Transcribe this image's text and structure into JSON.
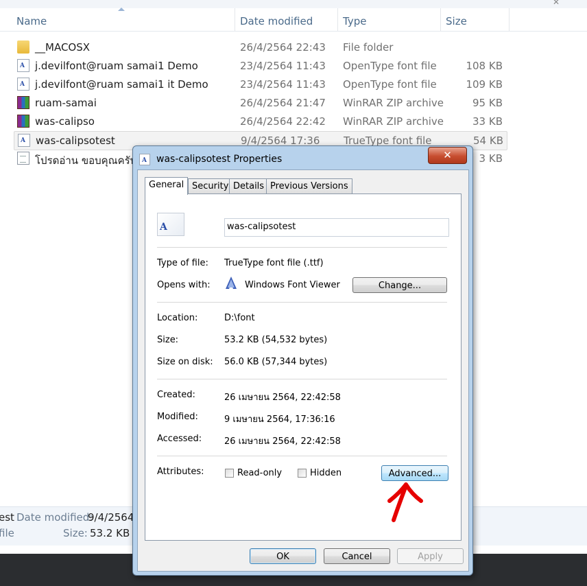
{
  "explorer": {
    "columns": {
      "name": "Name",
      "date": "Date modified",
      "type": "Type",
      "size": "Size"
    },
    "files": [
      {
        "name": "__MACOSX",
        "date": "26/4/2564 22:43",
        "type": "File folder",
        "size": "",
        "icon": "folder-icon"
      },
      {
        "name": "j.devilfont@ruam samai1 Demo",
        "date": "23/4/2564 11:43",
        "type": "OpenType font file",
        "size": "108 KB",
        "icon": "font-file-icon"
      },
      {
        "name": "j.devilfont@ruam samai1 it Demo",
        "date": "23/4/2564 11:43",
        "type": "OpenType font file",
        "size": "109 KB",
        "icon": "font-file-icon"
      },
      {
        "name": "ruam-samai",
        "date": "26/4/2564 21:47",
        "type": "WinRAR ZIP archive",
        "size": "95 KB",
        "icon": "winrar-archive-icon"
      },
      {
        "name": "was-calipso",
        "date": "26/4/2564 22:42",
        "type": "WinRAR ZIP archive",
        "size": "33 KB",
        "icon": "winrar-archive-icon"
      },
      {
        "name": "was-calipsotest",
        "date": "9/4/2564 17:36",
        "type": "TrueType font file",
        "size": "54 KB",
        "icon": "font-file-icon"
      },
      {
        "name": "โปรดอ่าน ขอบคุณครับ",
        "date": "",
        "type": "",
        "size": "3 KB",
        "icon": "text-document-icon"
      }
    ],
    "details": {
      "name_fragment": "est",
      "type_fragment": "file",
      "date_label": "Date modified:",
      "date_value": "9/4/2564",
      "size_label": "Size:",
      "size_value": "53.2 KB"
    }
  },
  "dialog": {
    "title": "was-calipsotest Properties",
    "close_label": "✕",
    "tabs": [
      "General",
      "Security",
      "Details",
      "Previous Versions"
    ],
    "active_tab": "General",
    "file_name": "was-calipsotest",
    "type_label": "Type of file:",
    "type_value": "TrueType font file (.ttf)",
    "opens_label": "Opens with:",
    "opens_value": "Windows Font Viewer",
    "change_button": "Change...",
    "location_label": "Location:",
    "location_value": "D:\\font",
    "size_label": "Size:",
    "size_value": "53.2 KB (54,532 bytes)",
    "size_disk_label": "Size on disk:",
    "size_disk_value": "56.0 KB (57,344 bytes)",
    "created_label": "Created:",
    "created_value": "26 เมษายน 2564, 22:42:58",
    "modified_label": "Modified:",
    "modified_value": "9 เมษายน 2564, 17:36:16",
    "accessed_label": "Accessed:",
    "accessed_value": "26 เมษายน 2564, 22:42:58",
    "attributes_label": "Attributes:",
    "readonly_label": "Read-only",
    "hidden_label": "Hidden",
    "advanced_button": "Advanced...",
    "ok_button": "OK",
    "cancel_button": "Cancel",
    "apply_button": "Apply"
  },
  "colors": {
    "selection_row": "#f3f3f3",
    "dialog_frame": "#b7d2ec",
    "close_button": "#c74d2f",
    "annotation_arrow": "#e60000"
  }
}
